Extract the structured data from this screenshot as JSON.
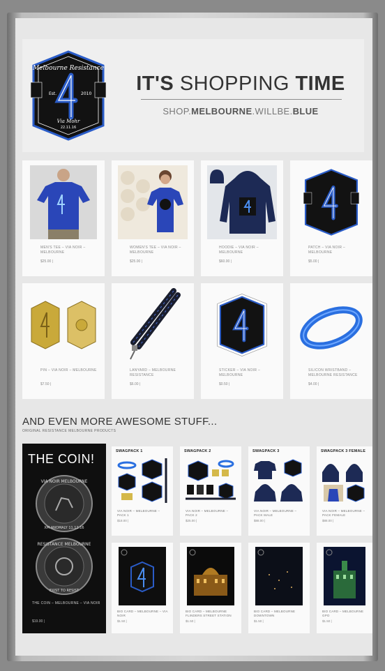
{
  "hero": {
    "title_light_1": "IT'S",
    "title_light_2": "SHOPPING",
    "title_bold": "TIME",
    "url_1": "SHOP.",
    "url_2": "MELBOURNE",
    "url_3": ".WILLBE.",
    "url_4": "BLUE",
    "badge": {
      "top": "Melbourne Resistance",
      "est": "Est.",
      "year": "2010",
      "bottom_1": "Via Mohr",
      "bottom_2": "22.11.16"
    }
  },
  "products": [
    {
      "name": "MEN'S TEE – VIA NOIR – MELBOURNE",
      "price": "$25.00 | "
    },
    {
      "name": "WOMEN'S TEE – VIA NOIR – MELBOURNE",
      "price": "$25.00 | "
    },
    {
      "name": "HOODIE – VIA NOIR – MELBOURNE",
      "price": "$60.00 | "
    },
    {
      "name": "PATCH – VIA NOIR – MELBOURNE",
      "price": "$5.00 | "
    },
    {
      "name": "PIN – VIA NOIR – MELBOURNE",
      "price": "$7.50 | "
    },
    {
      "name": "LANYARD – MELBOURNE RESISTANCE",
      "price": "$6.00 | "
    },
    {
      "name": "STICKER – VIA NOIR – MELBOURNE",
      "price": "$0.50 | "
    },
    {
      "name": "SILICON WRISTBAND – MELBOURNE RESISTANCE",
      "price": "$4.00 | "
    }
  ],
  "section": {
    "title": "AND EVEN MORE AWESOME STUFF...",
    "subtitle": "ORIGINAL RESISTANCE MELBOURNE PRODUCTS"
  },
  "coin": {
    "title": "THE COIN!",
    "ring_top": "VIA NOIR MELBOURNE",
    "ring_top_bottom": "XM ANOMALY 11.12.16",
    "ring_bottom": "RESISTANCE MELBOURNE",
    "ring_bottom_bottom": "EXIST TO RESIST",
    "name": "THE COIN – MELBOURNE – VIA NOIR",
    "price": "$19.00 | "
  },
  "swag": [
    {
      "title": "SWAGPACK 1",
      "name": "VIA NOIR – MELBOURNE – PACK 1",
      "price": "$18.00 | "
    },
    {
      "title": "SWAGPACK 2",
      "name": "VIA NOIR – MELBOURNE – PACK 2",
      "price": "$25.00 | "
    },
    {
      "title": "SWAGPACK 3",
      "name": "VIA NOIR – MELBOURNE – PACK MALE",
      "price": "$88.00 | "
    },
    {
      "title": "SWAGPACK 3 FEMALE",
      "name": "VIA NOIR – MELBOURNE – PACK FEMALE",
      "price": "$88.00 | "
    }
  ],
  "biocards": [
    {
      "name": "BIO CARD – MELBOURNE – VIA NOIR",
      "price": "$1.50 | "
    },
    {
      "name": "BIO CARD – MELBOURNE FLINDERS STREET STATION",
      "price": "$1.50 | "
    },
    {
      "name": "BIO CARD – MELBOURNE DOWNTOWN",
      "price": "$1.50 | "
    },
    {
      "name": "BIO CARD – MELBOURNE GPO",
      "price": "$1.50 | "
    }
  ],
  "colors": {
    "accent_blue": "#2a5cc8",
    "badge_dark": "#121212",
    "page": "#e7e7e7"
  }
}
